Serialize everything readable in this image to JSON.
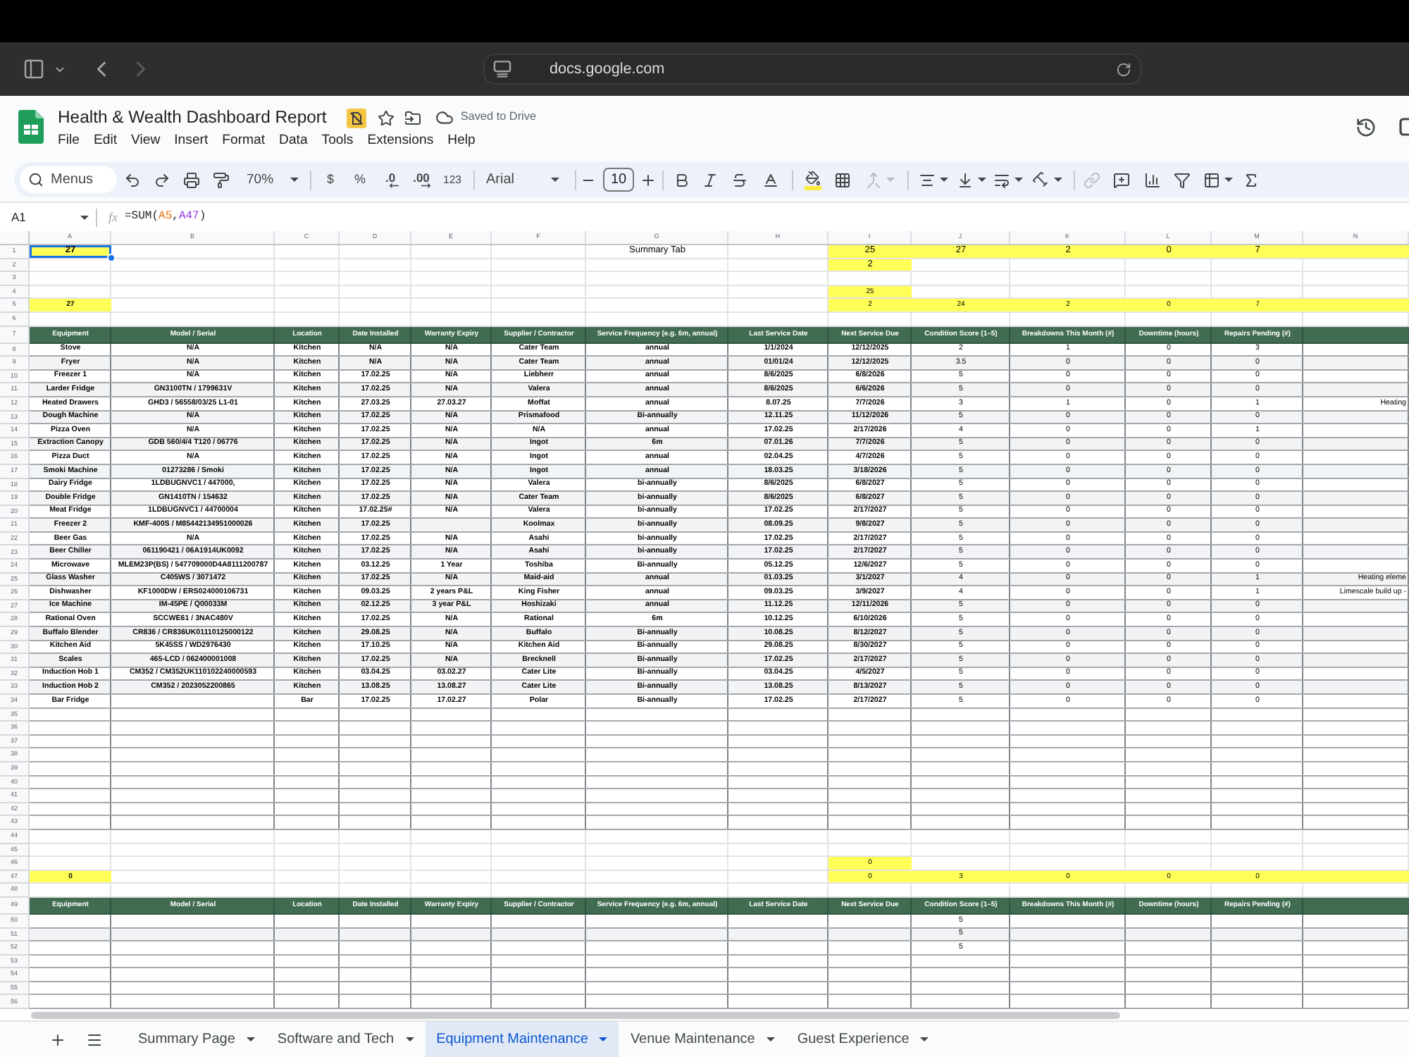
{
  "browser": {
    "url": "docs.google.com",
    "back": {
      "disabled": false
    },
    "forward": {
      "disabled": true
    }
  },
  "document": {
    "title": "Health & Wealth Dashboard Report",
    "save_status": "Saved to Drive",
    "menu": [
      "File",
      "Edit",
      "View",
      "Insert",
      "Format",
      "Data",
      "Tools",
      "Extensions",
      "Help"
    ]
  },
  "toolbar": {
    "search": "Menus",
    "zoom": "70%",
    "currency": "$",
    "percent": "%",
    "decrease_decimals": ".0",
    "increase_decimals": ".00",
    "number_format": "123",
    "font": "Arial",
    "font_size": "10",
    "merge_cells": {
      "disabled": true
    },
    "insert_link": {
      "disabled": true
    }
  },
  "formula_bar": {
    "cell": "A1",
    "function_label": "fx",
    "formula": [
      {
        "text": "=SUM("
      },
      {
        "text": "A5",
        "color": "#e8710a"
      },
      {
        "text": ","
      },
      {
        "text": "A47",
        "color": "#9334e6"
      },
      {
        "text": ")"
      }
    ]
  },
  "grid": {
    "columns": [
      "A",
      "B",
      "C",
      "D",
      "E",
      "F",
      "G",
      "H",
      "I",
      "J",
      "K",
      "L",
      "M",
      "N"
    ],
    "rows": [
      {
        "number": "1",
        "kind": "totals",
        "cells": {
          "column_1": {
            "text": "27",
            "highlighted": true,
            "selected": true
          },
          "column_7": {
            "text": "Summary Tab",
            "highlighted": false,
            "selected": false
          },
          "column_9": {
            "text": "25",
            "highlighted": true,
            "selected": false
          },
          "column_10": {
            "text": "27",
            "highlighted": true,
            "selected": false
          },
          "column_11": {
            "text": "2",
            "highlighted": true,
            "selected": false
          },
          "column_12": {
            "text": "0",
            "highlighted": true,
            "selected": false
          },
          "column_13": {
            "text": "7",
            "highlighted": true,
            "selected": false
          },
          "column_14": {
            "highlighted": true,
            "selected": false
          }
        }
      },
      {
        "number": "2",
        "kind": "totals",
        "cells": {
          "column_9": {
            "text": "2",
            "highlighted": true,
            "selected": false
          }
        }
      },
      {
        "number": "3",
        "kind": "summary"
      },
      {
        "number": "4",
        "kind": "summary",
        "cells": {
          "column_9": {
            "text": "25",
            "highlighted": true,
            "selected": false
          }
        }
      },
      {
        "number": "5",
        "kind": "summary",
        "cells": {
          "column_1": {
            "text": "27",
            "highlighted": true,
            "selected": false
          },
          "column_9": {
            "text": "2",
            "highlighted": true,
            "selected": false
          },
          "column_10": {
            "text": "24",
            "highlighted": true,
            "selected": false
          },
          "column_11": {
            "text": "2",
            "highlighted": true,
            "selected": false
          },
          "column_12": {
            "text": "0",
            "highlighted": true,
            "selected": false
          },
          "column_13": {
            "text": "7",
            "highlighted": true,
            "selected": false
          },
          "column_14": {
            "highlighted": true,
            "selected": false
          }
        }
      },
      {
        "number": "6",
        "kind": "summary"
      },
      {
        "number": "7",
        "kind": "header",
        "values": [
          "Equipment",
          "Model / Serial",
          "Location",
          "Date Installed",
          "Warranty Expiry",
          "Supplier / Contractor",
          "Service Frequency (e.g. 6m, annual)",
          "Last Service Date",
          "Next Service Due",
          "Condition Score (1–5)",
          "Breakdowns This Month (#)",
          "Downtime (hours)",
          "Repairs Pending (#)"
        ]
      },
      {
        "number": "8",
        "kind": "table",
        "values": {
          "equipment": "Stove",
          "model_serial": "N/A",
          "location": "Kitchen",
          "date_installed": "N/A",
          "warranty_expiry": "N/A",
          "supplier_contractor": "Cater Team",
          "service_frequency": "annual",
          "last_service_date": "1/1/2024",
          "next_service_due": "12/12/2025",
          "condition_score": "2",
          "breakdowns_this_month": "1",
          "downtime_hours": "0",
          "repairs_pending": "3"
        }
      },
      {
        "number": "9",
        "kind": "table",
        "values": {
          "equipment": "Fryer",
          "model_serial": "N/A",
          "location": "Kitchen",
          "date_installed": "N/A",
          "warranty_expiry": "N/A",
          "supplier_contractor": "Cater Team",
          "service_frequency": "annual",
          "last_service_date": "01/01/24",
          "next_service_due": "12/12/2025",
          "condition_score": "3.5",
          "breakdowns_this_month": "0",
          "downtime_hours": "0",
          "repairs_pending": "0"
        }
      },
      {
        "number": "10",
        "kind": "table",
        "values": {
          "equipment": "Freezer 1",
          "model_serial": "N/A",
          "location": "Kitchen",
          "date_installed": "17.02.25",
          "warranty_expiry": "N/A",
          "supplier_contractor": "Liebherr",
          "service_frequency": "annual",
          "last_service_date": "8/6/2025",
          "next_service_due": "6/8/2026",
          "condition_score": "5",
          "breakdowns_this_month": "0",
          "downtime_hours": "0",
          "repairs_pending": "0"
        }
      },
      {
        "number": "11",
        "kind": "table",
        "values": {
          "equipment": "Larder Fridge",
          "model_serial": "GN3100TN / 1799631V",
          "location": "Kitchen",
          "date_installed": "17.02.25",
          "warranty_expiry": "N/A",
          "supplier_contractor": "Valera",
          "service_frequency": "annual",
          "last_service_date": "8/6/2025",
          "next_service_due": "6/6/2026",
          "condition_score": "5",
          "breakdowns_this_month": "0",
          "downtime_hours": "0",
          "repairs_pending": "0"
        }
      },
      {
        "number": "12",
        "kind": "table",
        "values": {
          "equipment": "Heated Drawers",
          "model_serial": "GHD3 / 56558/03/25 L1-01",
          "location": "Kitchen",
          "date_installed": "27.03.25",
          "warranty_expiry": "27.03.27",
          "supplier_contractor": "Moffat",
          "service_frequency": "annual",
          "last_service_date": "8.07.25",
          "next_service_due": "7/7/2026",
          "condition_score": "3",
          "breakdowns_this_month": "1",
          "downtime_hours": "0",
          "repairs_pending": "1",
          "column_14": "Heating"
        }
      },
      {
        "number": "13",
        "kind": "table",
        "values": {
          "equipment": "Dough Machine",
          "model_serial": "N/A",
          "location": "Kitchen",
          "date_installed": "17.02.25",
          "warranty_expiry": "N/A",
          "supplier_contractor": "Prismafood",
          "service_frequency": "Bi-annually",
          "last_service_date": "12.11.25",
          "next_service_due": "11/12/2026",
          "condition_score": "5",
          "breakdowns_this_month": "0",
          "downtime_hours": "0",
          "repairs_pending": "0"
        }
      },
      {
        "number": "14",
        "kind": "table",
        "values": {
          "equipment": "Pizza Oven",
          "model_serial": "N/A",
          "location": "Kitchen",
          "date_installed": "17.02.25",
          "warranty_expiry": "N/A",
          "supplier_contractor": "N/A",
          "service_frequency": "annual",
          "last_service_date": "17.02.25",
          "next_service_due": "2/17/2026",
          "condition_score": "4",
          "breakdowns_this_month": "0",
          "downtime_hours": "0",
          "repairs_pending": "1"
        }
      },
      {
        "number": "15",
        "kind": "table",
        "values": {
          "equipment": "Extraction Canopy",
          "model_serial": "GDB 560/4/4 T120 / 06776",
          "location": "Kitchen",
          "date_installed": "17.02.25",
          "warranty_expiry": "N/A",
          "supplier_contractor": "Ingot",
          "service_frequency": "6m",
          "last_service_date": "07.01.26",
          "next_service_due": "7/7/2026",
          "condition_score": "5",
          "breakdowns_this_month": "0",
          "downtime_hours": "0",
          "repairs_pending": "0"
        }
      },
      {
        "number": "16",
        "kind": "table",
        "values": {
          "equipment": "Pizza Duct",
          "model_serial": "N/A",
          "location": "Kitchen",
          "date_installed": "17.02.25",
          "warranty_expiry": "N/A",
          "supplier_contractor": "Ingot",
          "service_frequency": "annual",
          "last_service_date": "02.04.25",
          "next_service_due": "4/7/2026",
          "condition_score": "5",
          "breakdowns_this_month": "0",
          "downtime_hours": "0",
          "repairs_pending": "0"
        }
      },
      {
        "number": "17",
        "kind": "table",
        "values": {
          "equipment": "Smoki Machine",
          "model_serial": "01273286 / Smoki",
          "location": "Kitchen",
          "date_installed": "17.02.25",
          "warranty_expiry": "N/A",
          "supplier_contractor": "Ingot",
          "service_frequency": "annual",
          "last_service_date": "18.03.25",
          "next_service_due": "3/18/2026",
          "condition_score": "5",
          "breakdowns_this_month": "0",
          "downtime_hours": "0",
          "repairs_pending": "0"
        }
      },
      {
        "number": "18",
        "kind": "table",
        "values": {
          "equipment": "Dairy Fridge",
          "model_serial": "1LDBUGNVC1 / 447000,",
          "location": "Kitchen",
          "date_installed": "17.02.25",
          "warranty_expiry": "N/A",
          "supplier_contractor": "Valera",
          "service_frequency": "bi-annually",
          "last_service_date": "8/6/2025",
          "next_service_due": "6/8/2027",
          "condition_score": "5",
          "breakdowns_this_month": "0",
          "downtime_hours": "0",
          "repairs_pending": "0"
        }
      },
      {
        "number": "19",
        "kind": "table",
        "values": {
          "equipment": "Double Fridge",
          "model_serial": "GN1410TN / 154632",
          "location": "Kitchen",
          "date_installed": "17.02.25",
          "warranty_expiry": "N/A",
          "supplier_contractor": "Cater Team",
          "service_frequency": "bi-annually",
          "last_service_date": "8/6/2025",
          "next_service_due": "6/8/2027",
          "condition_score": "5",
          "breakdowns_this_month": "0",
          "downtime_hours": "0",
          "repairs_pending": "0"
        }
      },
      {
        "number": "20",
        "kind": "table",
        "values": {
          "equipment": "Meat Fridge",
          "model_serial": "1LDBUGNVC1 / 44700004",
          "location": "Kitchen",
          "date_installed": "17.02.25#",
          "warranty_expiry": "N/A",
          "supplier_contractor": "Valera",
          "service_frequency": "bi-annually",
          "last_service_date": "17.02.25",
          "next_service_due": "2/17/2027",
          "condition_score": "5",
          "breakdowns_this_month": "0",
          "downtime_hours": "0",
          "repairs_pending": "0"
        }
      },
      {
        "number": "21",
        "kind": "table",
        "values": {
          "equipment": "Freezer 2",
          "model_serial": "KMF-400S / M85442134951000026",
          "location": "Kitchen",
          "date_installed": "17.02.25",
          "supplier_contractor": "Koolmax",
          "service_frequency": "bi-annually",
          "last_service_date": "08.09.25",
          "next_service_due": "9/8/2027",
          "condition_score": "5",
          "breakdowns_this_month": "0",
          "downtime_hours": "0",
          "repairs_pending": "0"
        }
      },
      {
        "number": "22",
        "kind": "table",
        "values": {
          "equipment": "Beer Gas",
          "model_serial": "N/A",
          "location": "Kitchen",
          "date_installed": "17.02.25",
          "warranty_expiry": "N/A",
          "supplier_contractor": "Asahi",
          "service_frequency": "bi-annually",
          "last_service_date": "17.02.25",
          "next_service_due": "2/17/2027",
          "condition_score": "5",
          "breakdowns_this_month": "0",
          "downtime_hours": "0",
          "repairs_pending": "0"
        }
      },
      {
        "number": "23",
        "kind": "table",
        "values": {
          "equipment": "Beer Chiller",
          "model_serial": "061190421 / 06A1914UK0092",
          "location": "Kitchen",
          "date_installed": "17.02.25",
          "warranty_expiry": "N/A",
          "supplier_contractor": "Asahi",
          "service_frequency": "bi-annually",
          "last_service_date": "17.02.25",
          "next_service_due": "2/17/2027",
          "condition_score": "5",
          "breakdowns_this_month": "0",
          "downtime_hours": "0",
          "repairs_pending": "0"
        }
      },
      {
        "number": "24",
        "kind": "table",
        "values": {
          "equipment": "Microwave",
          "model_serial": "MLEM23P(BS) / 547709000D4A8111200787",
          "location": "Kitchen",
          "date_installed": "03.12.25",
          "warranty_expiry": "1 Year",
          "supplier_contractor": "Toshiba",
          "service_frequency": "Bi-annually",
          "last_service_date": "05.12.25",
          "next_service_due": "12/6/2027",
          "condition_score": "5",
          "breakdowns_this_month": "0",
          "downtime_hours": "0",
          "repairs_pending": "0"
        }
      },
      {
        "number": "25",
        "kind": "table",
        "values": {
          "equipment": "Glass Washer",
          "model_serial": "C405WS / 3071472",
          "location": "Kitchen",
          "date_installed": "17.02.25",
          "warranty_expiry": "N/A",
          "supplier_contractor": "Maid-aid",
          "service_frequency": "annual",
          "last_service_date": "01.03.25",
          "next_service_due": "3/1/2027",
          "condition_score": "4",
          "breakdowns_this_month": "0",
          "downtime_hours": "0",
          "repairs_pending": "1",
          "column_14": "Heating eleme"
        }
      },
      {
        "number": "26",
        "kind": "table",
        "values": {
          "equipment": "Dishwasher",
          "model_serial": "KF1000DW / ERS024000106731",
          "location": "Kitchen",
          "date_installed": "09.03.25",
          "warranty_expiry": "2 years P&L",
          "supplier_contractor": "King Fisher",
          "service_frequency": "annual",
          "last_service_date": "09.03.25",
          "next_service_due": "3/9/2027",
          "condition_score": "4",
          "breakdowns_this_month": "0",
          "downtime_hours": "0",
          "repairs_pending": "1",
          "column_14": "Limescale build up -"
        }
      },
      {
        "number": "27",
        "kind": "table",
        "values": {
          "equipment": "Ice Machine",
          "model_serial": "IM-45PE / Q00033M",
          "location": "Kitchen",
          "date_installed": "02.12.25",
          "warranty_expiry": "3 year P&L",
          "supplier_contractor": "Hoshizaki",
          "service_frequency": "annual",
          "last_service_date": "11.12.25",
          "next_service_due": "12/11/2026",
          "condition_score": "5",
          "breakdowns_this_month": "0",
          "downtime_hours": "0",
          "repairs_pending": "0"
        }
      },
      {
        "number": "28",
        "kind": "table",
        "values": {
          "equipment": "Rational Oven",
          "model_serial": "SCCWE61 / 3NAC480V",
          "location": "Kitchen",
          "date_installed": "17.02.25",
          "warranty_expiry": "N/A",
          "supplier_contractor": "Rational",
          "service_frequency": "6m",
          "last_service_date": "10.12.25",
          "next_service_due": "6/10/2026",
          "condition_score": "5",
          "breakdowns_this_month": "0",
          "downtime_hours": "0",
          "repairs_pending": "0"
        }
      },
      {
        "number": "29",
        "kind": "table",
        "values": {
          "equipment": "Buffalo Blender",
          "model_serial": "CR836 / CR836UK01110125000122",
          "location": "Kitchen",
          "date_installed": "29.08.25",
          "warranty_expiry": "N/A",
          "supplier_contractor": "Buffalo",
          "service_frequency": "Bi-annually",
          "last_service_date": "10.08.25",
          "next_service_due": "8/12/2027",
          "condition_score": "5",
          "breakdowns_this_month": "0",
          "downtime_hours": "0",
          "repairs_pending": "0"
        }
      },
      {
        "number": "30",
        "kind": "table",
        "values": {
          "equipment": "Kitchen Aid",
          "model_serial": "5K45SS / WD2976430",
          "location": "Kitchen",
          "date_installed": "17.10.25",
          "warranty_expiry": "N/A",
          "supplier_contractor": "Kitchen Aid",
          "service_frequency": "Bi-annually",
          "last_service_date": "29.08.25",
          "next_service_due": "8/30/2027",
          "condition_score": "5",
          "breakdowns_this_month": "0",
          "downtime_hours": "0",
          "repairs_pending": "0"
        }
      },
      {
        "number": "31",
        "kind": "table",
        "values": {
          "equipment": "Scales",
          "model_serial": "465-LCD / 062400001008",
          "location": "Kitchen",
          "date_installed": "17.02.25",
          "warranty_expiry": "N/A",
          "supplier_contractor": "Brecknell",
          "service_frequency": "Bi-annually",
          "last_service_date": "17.02.25",
          "next_service_due": "2/17/2027",
          "condition_score": "5",
          "breakdowns_this_month": "0",
          "downtime_hours": "0",
          "repairs_pending": "0"
        }
      },
      {
        "number": "32",
        "kind": "table",
        "values": {
          "equipment": "Induction Hob 1",
          "model_serial": "CM352 / CM352UK110102240000593",
          "location": "Kitchen",
          "date_installed": "03.04.25",
          "warranty_expiry": "03.02.27",
          "supplier_contractor": "Cater Lite",
          "service_frequency": "Bi-annually",
          "last_service_date": "03.04.25",
          "next_service_due": "4/5/2027",
          "condition_score": "5",
          "breakdowns_this_month": "0",
          "downtime_hours": "0",
          "repairs_pending": "0"
        }
      },
      {
        "number": "33",
        "kind": "table",
        "values": {
          "equipment": "Induction Hob 2",
          "model_serial": "CM352 / 2023052200865",
          "location": "Kitchen",
          "date_installed": "13.08.25",
          "warranty_expiry": "13.08.27",
          "supplier_contractor": "Cater Lite",
          "service_frequency": "Bi-annually",
          "last_service_date": "13.08.25",
          "next_service_due": "8/13/2027",
          "condition_score": "5",
          "breakdowns_this_month": "0",
          "downtime_hours": "0",
          "repairs_pending": "0"
        }
      },
      {
        "number": "34",
        "kind": "table",
        "values": {
          "equipment": "Bar Fridge",
          "location": "Bar",
          "date_installed": "17.02.25",
          "warranty_expiry": "17.02.27",
          "supplier_contractor": "Polar",
          "service_frequency": "Bi-annually",
          "last_service_date": "17.02.25",
          "next_service_due": "2/17/2027",
          "condition_score": "5",
          "breakdowns_this_month": "0",
          "downtime_hours": "0",
          "repairs_pending": "0"
        }
      },
      {
        "number": "35",
        "kind": "table"
      },
      {
        "number": "36",
        "kind": "table"
      },
      {
        "number": "37",
        "kind": "table"
      },
      {
        "number": "38",
        "kind": "table"
      },
      {
        "number": "39",
        "kind": "table"
      },
      {
        "number": "40",
        "kind": "table"
      },
      {
        "number": "41",
        "kind": "table"
      },
      {
        "number": "42",
        "kind": "table"
      },
      {
        "number": "43",
        "kind": "table"
      },
      {
        "number": "44",
        "kind": "summary"
      },
      {
        "number": "45",
        "kind": "summary"
      },
      {
        "number": "46",
        "kind": "summary",
        "cells": {
          "column_9": {
            "text": "0",
            "highlighted": true,
            "selected": false
          }
        }
      },
      {
        "number": "47",
        "kind": "summary",
        "cells": {
          "column_1": {
            "text": "0",
            "highlighted": true,
            "selected": false
          },
          "column_9": {
            "text": "0",
            "highlighted": true,
            "selected": false
          },
          "column_10": {
            "text": "3",
            "highlighted": true,
            "selected": false
          },
          "column_11": {
            "text": "0",
            "highlighted": true,
            "selected": false
          },
          "column_12": {
            "text": "0",
            "highlighted": true,
            "selected": false
          },
          "column_13": {
            "text": "0",
            "highlighted": true,
            "selected": false
          },
          "column_14": {
            "highlighted": true,
            "selected": false
          }
        }
      },
      {
        "number": "48",
        "kind": "summary"
      },
      {
        "number": "49",
        "kind": "header",
        "values": [
          "Equipment",
          "Model / Serial",
          "Location",
          "Date Installed",
          "Warranty Expiry",
          "Supplier / Contractor",
          "Service Frequency (e.g. 6m, annual)",
          "Last Service Date",
          "Next Service Due",
          "Condition Score (1–5)",
          "Breakdowns This Month (#)",
          "Downtime (hours)",
          "Repairs Pending (#)"
        ]
      },
      {
        "number": "50",
        "kind": "table",
        "values": {
          "condition_score": "5"
        }
      },
      {
        "number": "51",
        "kind": "table",
        "values": {
          "condition_score": "5"
        }
      },
      {
        "number": "52",
        "kind": "table",
        "values": {
          "condition_score": "5"
        }
      },
      {
        "number": "53",
        "kind": "table"
      },
      {
        "number": "54",
        "kind": "table"
      },
      {
        "number": "55",
        "kind": "table"
      },
      {
        "number": "56",
        "kind": "table"
      }
    ]
  },
  "sheet_tabs": [
    {
      "label": "Summary Page",
      "selected": false
    },
    {
      "label": "Software and Tech",
      "selected": false
    },
    {
      "label": "Equipment Maintenance",
      "selected": true
    },
    {
      "label": "Venue Maintenance",
      "selected": false
    },
    {
      "label": "Guest Experience",
      "selected": false
    }
  ]
}
